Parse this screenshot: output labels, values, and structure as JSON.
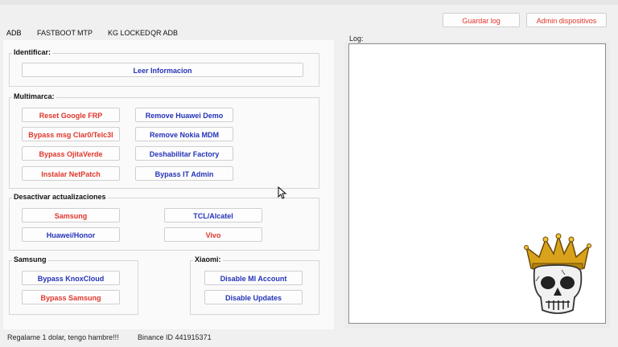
{
  "tabs": [
    {
      "label": "ADB"
    },
    {
      "label": "FASTBOOT"
    },
    {
      "label": "MTP"
    },
    {
      "label": "KG LOCKED"
    },
    {
      "label": "QR ADB"
    }
  ],
  "header": {
    "save_log_label": "Guardar log",
    "device_admin_label": "Admin dispositivos"
  },
  "identify": {
    "title": "Identificar:",
    "read_info_label": "Leer Informacion"
  },
  "multibrand": {
    "title": "Multimarca:",
    "reset_frp": "Reset Google FRP",
    "bypass_msg": "Bypass msg Clar0/Telc3l",
    "bypass_ojita": "Bypass OjitaVerde",
    "install_netpatch": "Instalar NetPatch",
    "remove_huawei_demo": "Remove Huawei Demo",
    "remove_nokia_mdm": "Remove Nokia MDM",
    "disable_factory": "Deshabilitar Factory",
    "bypass_it_admin": "Bypass IT Admin"
  },
  "updates": {
    "title": "Desactivar actualizaciones",
    "samsung": "Samsung",
    "tcl_alcatel": "TCL/Alcatel",
    "huawei_honor": "Huawei/Honor",
    "vivo": "Vivo"
  },
  "samsung": {
    "title": "Samsung",
    "bypass_knoxcloud": "Bypass KnoxCloud",
    "bypass_samsung": "Bypass Samsung"
  },
  "xiaomi": {
    "title": "Xiaomi:",
    "disable_mi_account": "Disable MI Account",
    "disable_updates": "Disable Updates"
  },
  "log": {
    "label": "Log:"
  },
  "status": {
    "donate_text": "Regalame 1 dolar, tengo hambre!!!",
    "binance_text": "Binance ID 441915371"
  },
  "colors": {
    "red": "#e0362b",
    "blue": "#2433b8"
  },
  "icons": [
    "mouse-cursor-icon",
    "crowned-skull-logo"
  ]
}
